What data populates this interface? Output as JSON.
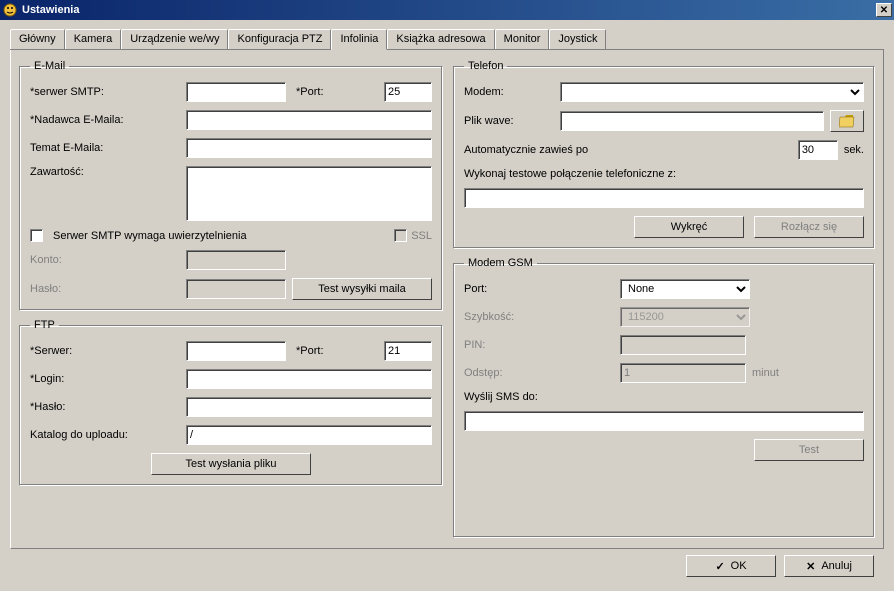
{
  "window": {
    "title": "Ustawienia"
  },
  "tabs": {
    "items": [
      "Główny",
      "Kamera",
      "Urządzenie we/wy",
      "Konfiguracja PTZ",
      "Infolinia",
      "Książka adresowa",
      "Monitor",
      "Joystick"
    ],
    "active_index": 4
  },
  "email": {
    "legend": "E-Mail",
    "smtp_label": "*serwer SMTP:",
    "smtp_value": "",
    "port_label": "*Port:",
    "port_value": "25",
    "sender_label": "*Nadawca E-Maila:",
    "sender_value": "",
    "subject_label": "Temat E-Maila:",
    "subject_value": "",
    "body_label": "Zawartość:",
    "body_value": "",
    "auth_label": "Serwer SMTP wymaga uwierzytelnienia",
    "ssl_label": "SSL",
    "account_label": "Konto:",
    "account_value": "",
    "password_label": "Hasło:",
    "password_value": "",
    "test_button": "Test wysyłki maila"
  },
  "ftp": {
    "legend": "FTP",
    "server_label": "*Serwer:",
    "server_value": "",
    "port_label": "*Port:",
    "port_value": "21",
    "login_label": "*Login:",
    "login_value": "",
    "password_label": "*Hasło:",
    "password_value": "",
    "dir_label": "Katalog do uploadu:",
    "dir_value": "/",
    "test_button": "Test wysłania pliku"
  },
  "phone": {
    "legend": "Telefon",
    "modem_label": "Modem:",
    "modem_value": "",
    "wave_label": "Plik wave:",
    "wave_value": "",
    "hangup_label_pre": "Automatycznie zawieś po",
    "hangup_value": "30",
    "hangup_label_post": "sek.",
    "test_label": "Wykonaj testowe połączenie telefoniczne z:",
    "test_value": "",
    "dial_button": "Wykręć",
    "hangup_button": "Rozłącz się"
  },
  "gsm": {
    "legend": "Modem GSM",
    "port_label": "Port:",
    "port_value": "None",
    "speed_label": "Szybkość:",
    "speed_value": "115200",
    "pin_label": "PIN:",
    "pin_value": "",
    "interval_label": "Odstęp:",
    "interval_value": "1",
    "interval_unit": "minut",
    "sms_label": "Wyślij SMS do:",
    "sms_value": "",
    "test_button": "Test"
  },
  "buttons": {
    "ok": "OK",
    "cancel": "Anuluj"
  }
}
